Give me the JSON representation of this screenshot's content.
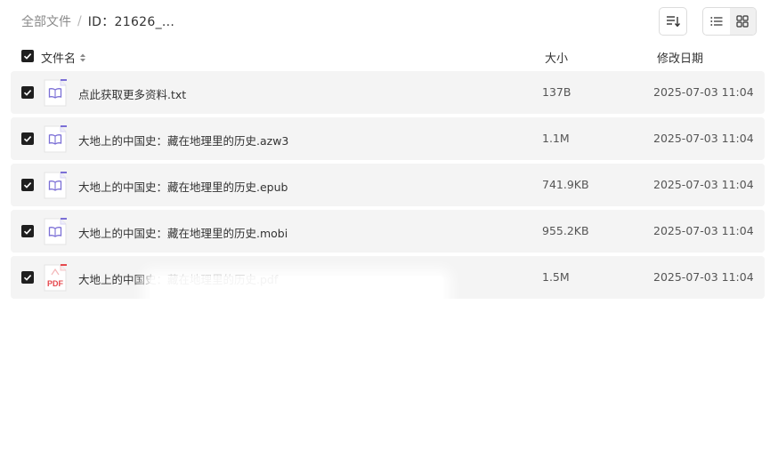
{
  "breadcrumb": {
    "root": "全部文件",
    "separator": "/",
    "current": "ID：21626_..."
  },
  "toolbar": {
    "sort_icon": "sort-icon",
    "list_view_icon": "list-view-icon",
    "grid_view_icon": "grid-view-icon",
    "active_view": "list"
  },
  "table": {
    "headers": {
      "name": "文件名",
      "size": "大小",
      "date": "修改日期"
    },
    "rows": [
      {
        "name": "点此获取更多资料.txt",
        "size": "137B",
        "date": "2025-07-03 11:04",
        "icon": "book-file-icon",
        "checked": true
      },
      {
        "name": "大地上的中国史：藏在地理里的历史.azw3",
        "size": "1.1M",
        "date": "2025-07-03 11:04",
        "icon": "book-file-icon",
        "checked": true
      },
      {
        "name": "大地上的中国史：藏在地理里的历史.epub",
        "size": "741.9KB",
        "date": "2025-07-03 11:04",
        "icon": "book-file-icon",
        "checked": true
      },
      {
        "name": "大地上的中国史：藏在地理里的历史.mobi",
        "size": "955.2KB",
        "date": "2025-07-03 11:04",
        "icon": "book-file-icon",
        "checked": true
      },
      {
        "name": "大地上的中国史：藏在地理里的历史.pdf",
        "size": "1.5M",
        "date": "2025-07-03 11:04",
        "icon": "pdf-file-icon",
        "icon_label": "PDF",
        "checked": true
      }
    ]
  },
  "colors": {
    "row_bg": "#f4f4f4",
    "checkbox": "#1f1f1f",
    "book_icon": "#7b6fd6",
    "pdf_icon": "#e5484d"
  }
}
